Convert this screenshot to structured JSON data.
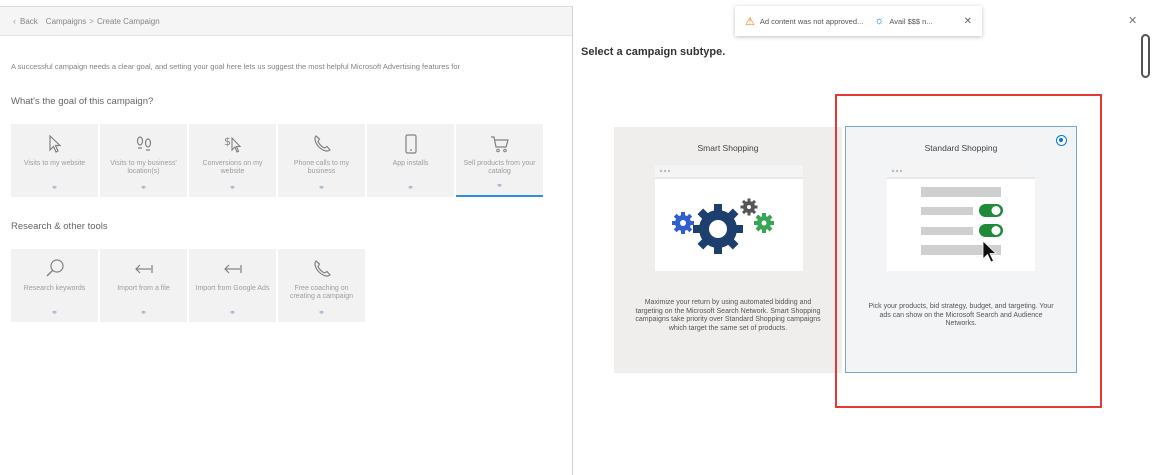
{
  "left_page": {
    "breadcrumb": {
      "back_label": "Back",
      "items": [
        "Campaigns",
        "Create Campaign"
      ]
    },
    "intro_text": "A successful campaign needs a clear goal, and setting your goal here lets us suggest the most helpful Microsoft Advertising features for",
    "goal_section_title": "What's the goal of this campaign?",
    "goals": [
      {
        "label": "Visits to my website",
        "icon": "cursor-icon"
      },
      {
        "label": "Visits to my business' location(s)",
        "icon": "footprints-icon"
      },
      {
        "label": "Conversions on my website",
        "icon": "dollar-cursor-icon"
      },
      {
        "label": "Phone calls to my business",
        "icon": "phone-icon"
      },
      {
        "label": "App installs",
        "icon": "mobile-icon"
      },
      {
        "label": "Sell products from your catalog",
        "icon": "cart-icon",
        "selected": true
      }
    ],
    "research_section_title": "Research & other tools",
    "tools": [
      {
        "label": "Research keywords",
        "icon": "magnifier-icon"
      },
      {
        "label": "Import from a file",
        "icon": "import-arrow-icon"
      },
      {
        "label": "Import from Google Ads",
        "icon": "import-arrow-icon"
      },
      {
        "label": "Free coaching on creating a campaign",
        "icon": "phone-icon"
      }
    ]
  },
  "notification": {
    "message_1": "Ad content was not approved...",
    "message_2": "Avail $$$ n..."
  },
  "panel": {
    "title": "Select a campaign subtype.",
    "smart": {
      "title": "Smart Shopping",
      "description": "Maximize your return by using automated bidding and targeting on the Microsoft Search Network. Smart Shopping campaigns take priority over Standard Shopping campaigns which target the same set of products."
    },
    "standard": {
      "title": "Standard Shopping",
      "description": "Pick your products, bid strategy, budget, and targeting. Your ads can show on the Microsoft Search and Audience Networks.",
      "selected": true
    }
  },
  "colors": {
    "accent": "#0078d4",
    "highlight": "#e53935",
    "toggle_green": "#1f8a3a"
  }
}
